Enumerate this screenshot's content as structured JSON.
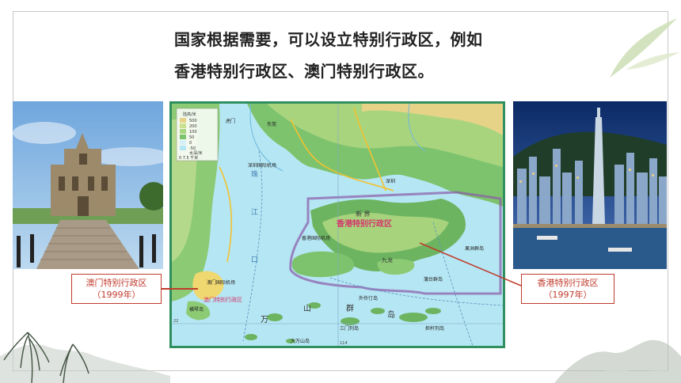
{
  "heading": {
    "line1": "国家根据需要，可以设立特别行政区，例如",
    "line2": "香港特别行政区、澳门特别行政区。"
  },
  "callouts": {
    "macau": {
      "name": "澳门特别行政区",
      "year": "（1999年）"
    },
    "hongkong": {
      "name": "香港特别行政区",
      "year": "（1997年）"
    }
  },
  "map": {
    "legend": {
      "title": "陆高/米",
      "levels": [
        "500",
        "200",
        "100",
        "50",
        "0",
        "-50"
      ],
      "bottom": "水深/米",
      "scale": "0    7.5 千米"
    },
    "labels": {
      "hk_region": "香港特别行政区",
      "macau_region": "澳门特别行政区",
      "shenzhen_airport": "深圳国际机场",
      "hk_airport": "香港国际机场",
      "macau_airport": "澳门国际机场",
      "zhujiang_1": "珠",
      "zhujiang_2": "江",
      "zhujiang_3": "口",
      "wanshan_1": "万",
      "wanshan_2": "山",
      "wanshan_3": "群",
      "wanshan_4": "岛",
      "xinjie": "新 界",
      "jiulong": "九龙",
      "dongguan": "东莞",
      "humen": "虎门",
      "shenzhen": "深圳",
      "guoyu": "果洲群岛",
      "lamma": "蒲台群岛",
      "hengqin": "横琴岛",
      "dangan": "担杆列岛",
      "sanmen": "三门列岛",
      "dawanshan": "大万山岛",
      "wailing": "外伶仃岛",
      "lat22": "22",
      "lon114": "114"
    }
  }
}
